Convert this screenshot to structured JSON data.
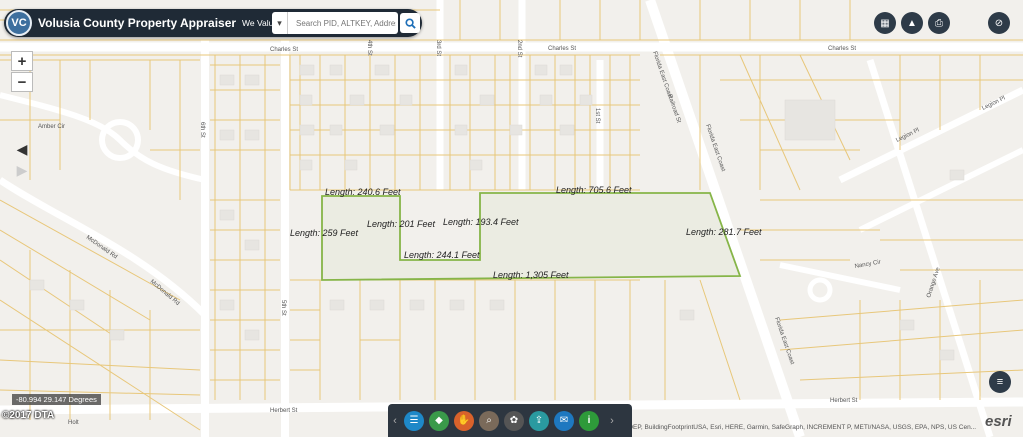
{
  "header": {
    "logo_text": "VC",
    "title": "Volusia County Property Appraiser",
    "slogan": "We Value Volusia!",
    "search_placeholder": "Search PID, ALTKEY, Address",
    "dropdown_icon": "chevron-down-icon",
    "search_icon": "search-icon"
  },
  "controls": {
    "zoom_in": "+",
    "zoom_out": "−",
    "back": "◀",
    "forward": "▶"
  },
  "right_buttons": [
    {
      "name": "basemap-button",
      "icon": "grid-icon",
      "glyph": "▦"
    },
    {
      "name": "graduation-button",
      "icon": "mortarboard-icon",
      "glyph": "▲"
    },
    {
      "name": "print-button",
      "icon": "printer-icon",
      "glyph": "⎙"
    },
    {
      "name": "visibility-button",
      "icon": "eye-off-icon",
      "glyph": "⊘"
    }
  ],
  "list_button_glyph": "≡",
  "coordinates": "-80.994 29.147 Degrees",
  "year_watermark": "©2017 DTA",
  "attribution": "Esri Community Maps Contributors, FDEP, BuildingFootprintUSA, Esri, HERE, Garmin, SafeGraph, INCREMENT P, METI/NASA, USGS, EPA, NPS, US Cen...",
  "esri_logo": "esri",
  "toolbar": {
    "prev": "‹",
    "next": "›",
    "buttons": [
      {
        "name": "legend-button",
        "icon": "list-icon",
        "color": "#1e88c8",
        "glyph": "☰"
      },
      {
        "name": "layers-button",
        "icon": "layers-icon",
        "color": "#3a9a4a",
        "glyph": "◆"
      },
      {
        "name": "draw-button",
        "icon": "hand-icon",
        "color": "#d9622b",
        "glyph": "✋"
      },
      {
        "name": "identify-button",
        "icon": "magnify-icon",
        "color": "#7a6a5a",
        "glyph": "⌕"
      },
      {
        "name": "basemap-gallery-button",
        "icon": "palette-icon",
        "color": "#555555",
        "glyph": "✿"
      },
      {
        "name": "export-button",
        "icon": "share-icon",
        "color": "#2a9aa0",
        "glyph": "⇪"
      },
      {
        "name": "email-button",
        "icon": "envelope-icon",
        "color": "#1e78c0",
        "glyph": "✉"
      },
      {
        "name": "info-button",
        "icon": "info-icon",
        "color": "#2e9a3a",
        "glyph": "i"
      }
    ]
  },
  "streets": {
    "charles_west": "Charles St",
    "charles_mid": "Charles St",
    "charles_east": "Charles St",
    "herbert_west": "Herbert St",
    "herbert_east": "Herbert St",
    "sixth": "6th St",
    "fifth": "5th St",
    "fourth": "4th St",
    "third": "3rd St",
    "second": "2nd St",
    "first": "1st St",
    "amber": "Amber Cir",
    "mcdonald1": "McDonald Rd",
    "mcdonald2": "McDonald Rd",
    "fec1": "Florida East Coast",
    "fec2": "Florida East Coast",
    "fec3": "Florida East Coast",
    "railroad": "Railroad St",
    "legion1": "Legion Pl",
    "legion2": "Legion Pl",
    "nancy": "Nancy Cir",
    "orange": "Orange Ave",
    "holt": "Holt"
  },
  "measurements": {
    "top_west": "Length: 240.6 Feet",
    "top_east": "Length: 705.6 Feet",
    "west_side": "Length: 259 Feet",
    "inner_left": "Length: 201 Feet",
    "inner_right": "Length: 193.4 Feet",
    "inner_bottom": "Length: 244.1 Feet",
    "east_side": "Length: 281.7 Feet",
    "bottom": "Length: 1,305 Feet"
  },
  "colors": {
    "parcel_line": "#e8c77a",
    "measure_line": "#86b548",
    "street_white": "#ffffff",
    "header_bg": "#1f2a36"
  }
}
